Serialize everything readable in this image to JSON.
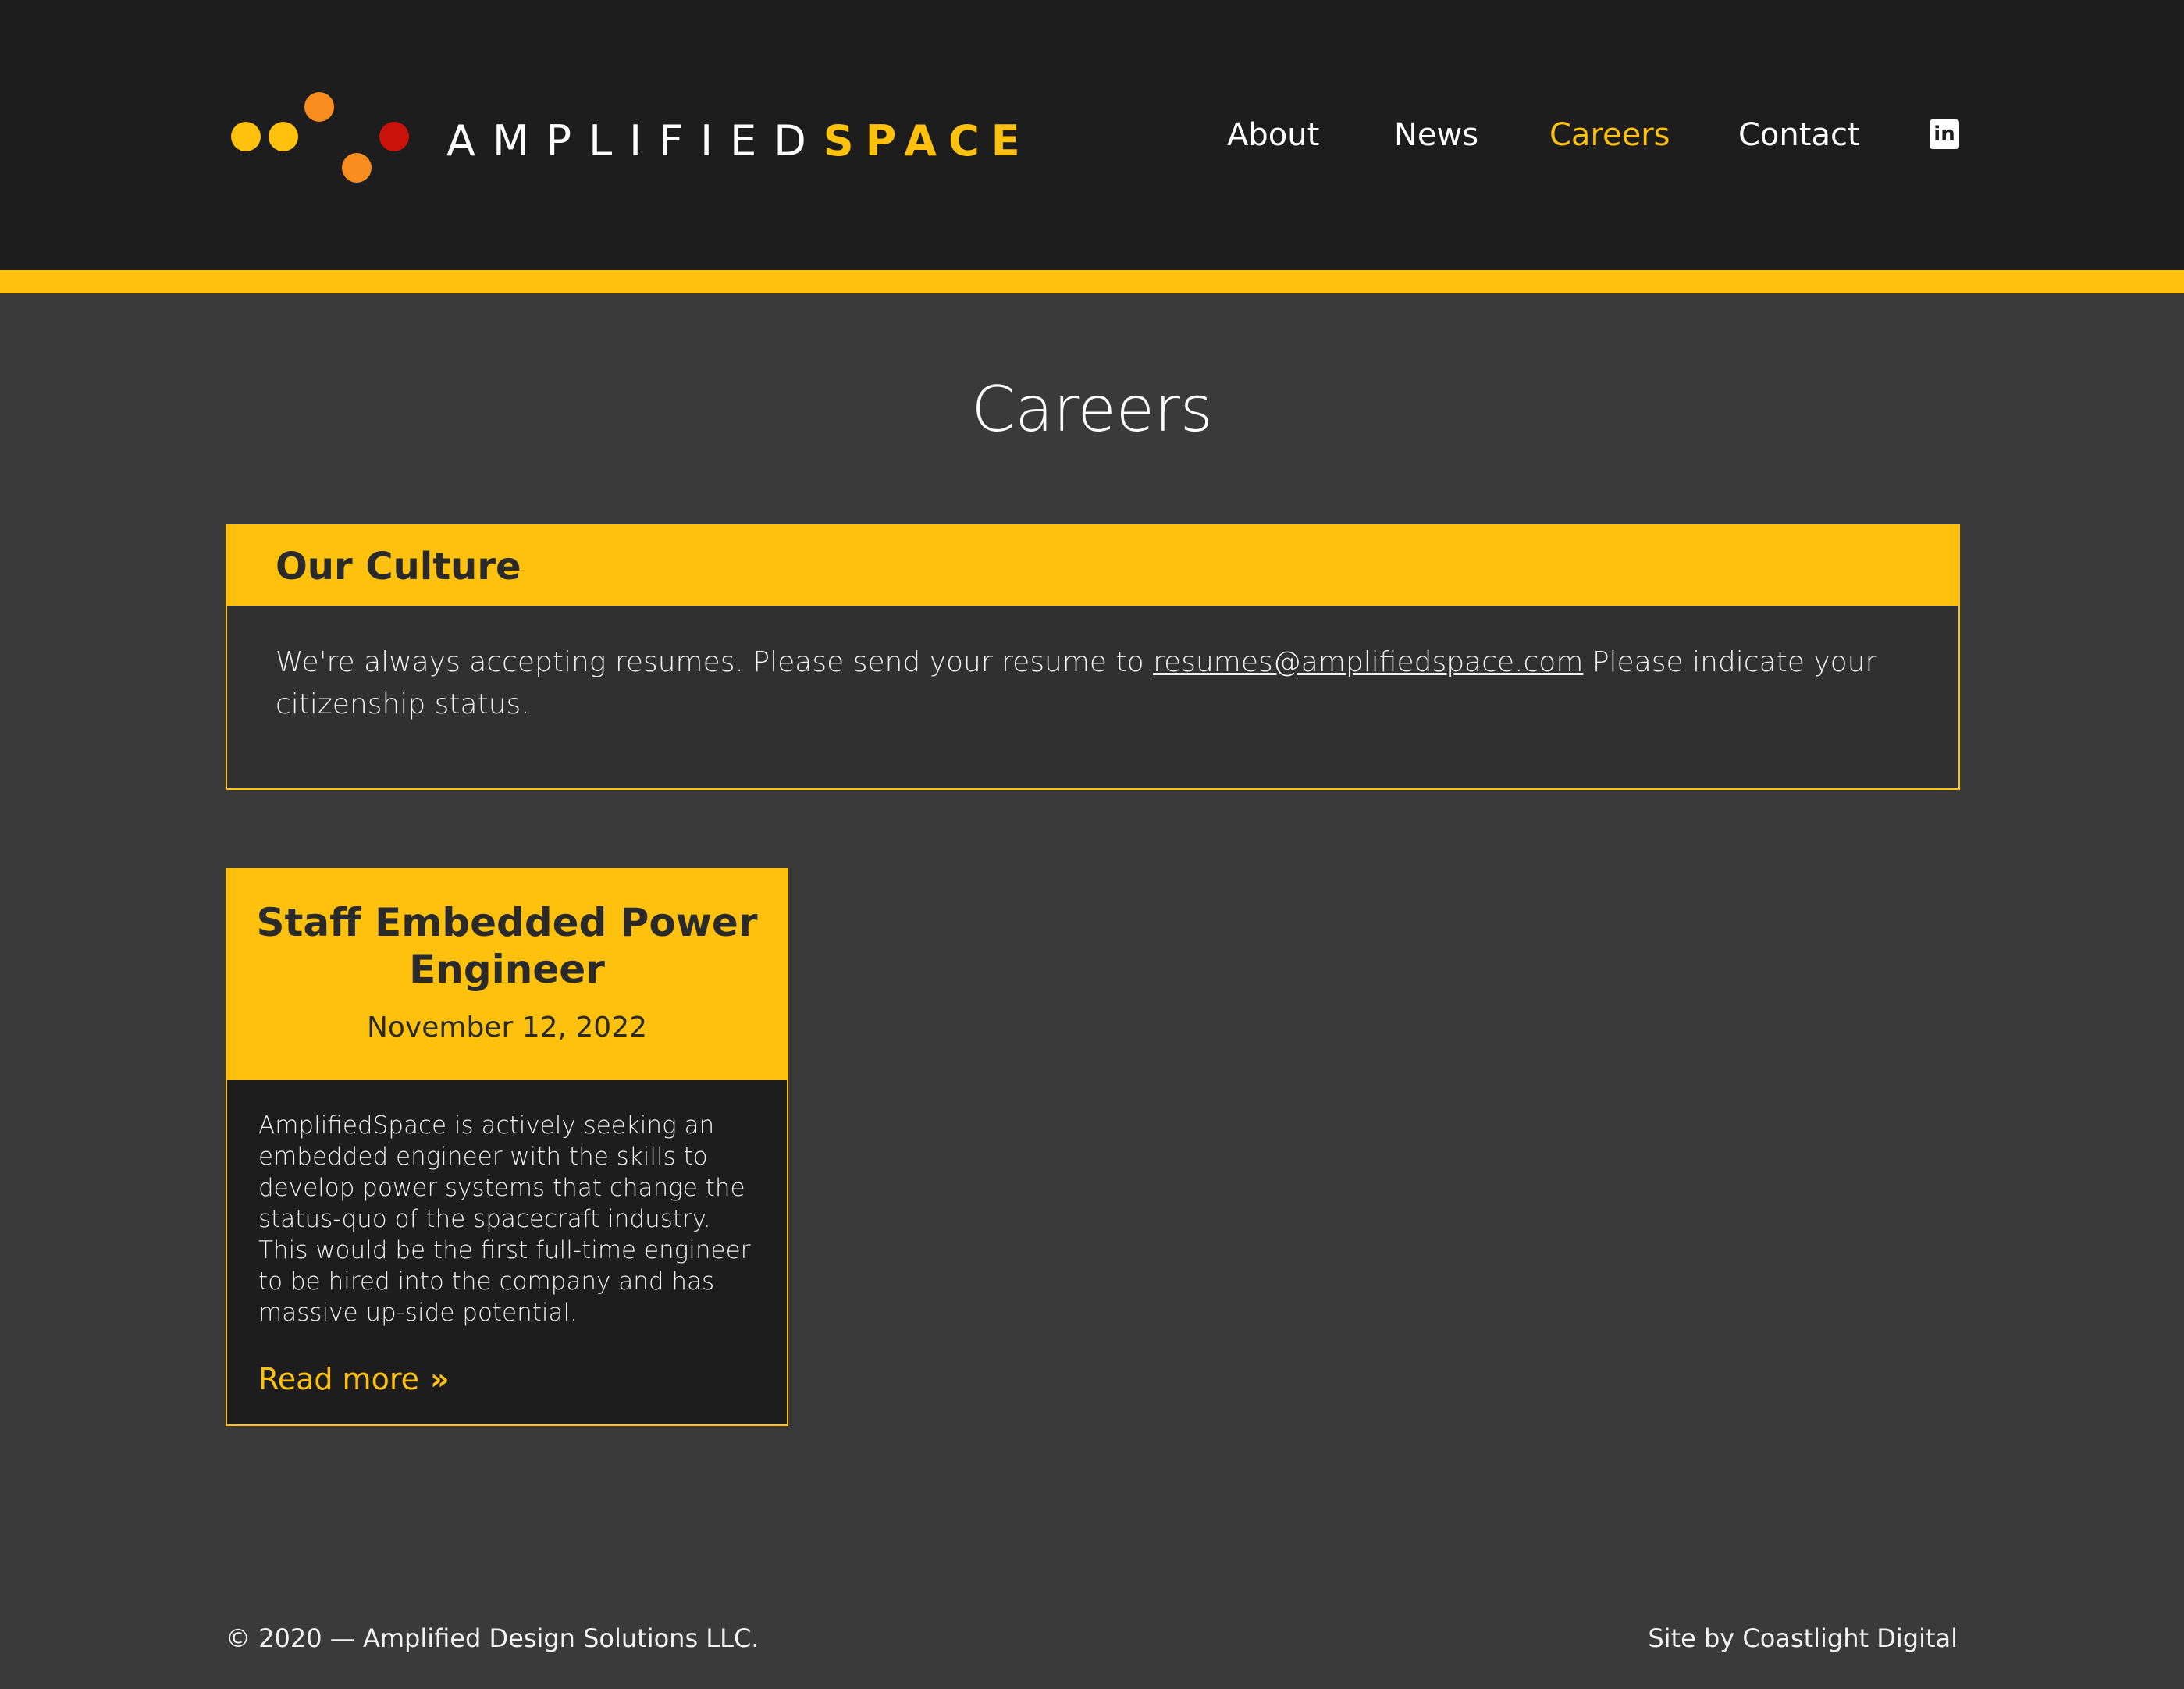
{
  "brand": {
    "name_light": "AMPLIFIED",
    "name_bold": "SPACE",
    "colors": {
      "accent": "#fec10e",
      "orange": "#fa8d1f",
      "red": "#c8120a",
      "header_bg": "#1d1d1d",
      "page_bg": "#3a3a3a"
    }
  },
  "nav": {
    "items": [
      {
        "label": "About",
        "active": false
      },
      {
        "label": "News",
        "active": false
      },
      {
        "label": "Careers",
        "active": true
      },
      {
        "label": "Contact",
        "active": false
      }
    ],
    "linkedin_icon": "in"
  },
  "page": {
    "title": "Careers"
  },
  "culture": {
    "title": "Our Culture",
    "text_before": "We're always accepting resumes. Please send your resume to ",
    "email": "resumes@amplifiedspace.com",
    "text_after": " Please indicate your citizenship status."
  },
  "job": {
    "title": "Staff Embedded Power Engineer",
    "date": "November 12, 2022",
    "description": "AmplifiedSpace is actively seeking an embedded engineer with the skills to develop power systems that change the status-quo of the spacecraft industry. This would be the first full-time engineer to be hired into the company and has massive up-side potential.",
    "read_more": "Read more",
    "read_more_icon": "»"
  },
  "footer": {
    "copyright": "© 2020 — Amplified Design Solutions LLC.",
    "credit": "Site by Coastlight Digital"
  }
}
